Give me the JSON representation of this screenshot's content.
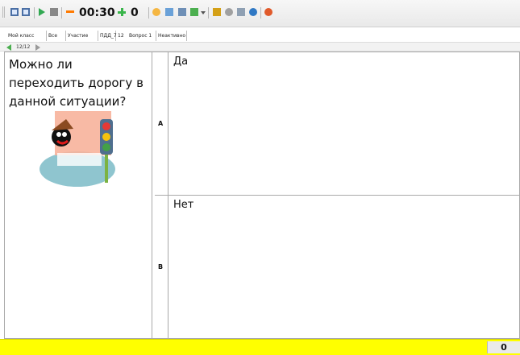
{
  "toolbar": {
    "timer": "00:30",
    "counter": "0"
  },
  "info": {
    "items": [
      "Мой класс",
      "Все",
      "Участие",
      "ПДД_7",
      "12",
      "Вопрос 1",
      "Неактивно"
    ]
  },
  "nav": {
    "page": "12/12"
  },
  "question": {
    "text": "Можно ли переходить дорогу в данной ситуации?"
  },
  "answers": [
    {
      "letter": "A",
      "text": "Да"
    },
    {
      "letter": "B",
      "text": "Нет"
    }
  ],
  "status": {
    "score": "0"
  },
  "colors": {
    "status_bar": "#ffff00",
    "minus": "#ff7a00",
    "plus": "#39b54a"
  }
}
